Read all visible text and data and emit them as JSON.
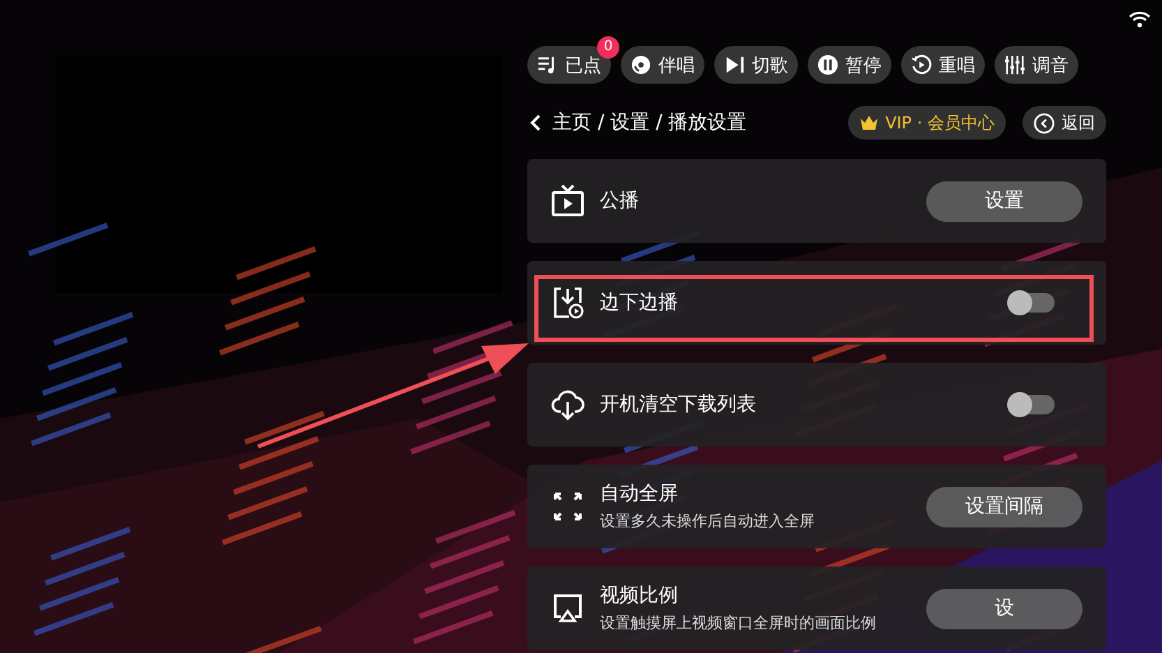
{
  "toolbar": [
    {
      "label": "已点",
      "badge": "0"
    },
    {
      "label": "伴唱"
    },
    {
      "label": "切歌"
    },
    {
      "label": "暂停"
    },
    {
      "label": "重唱"
    },
    {
      "label": "调音"
    }
  ],
  "breadcrumb": "主页 / 设置 / 播放设置",
  "vip_button": "VIP · 会员中心",
  "back_button": "返回",
  "settings": [
    {
      "kind": "button",
      "title": "公播",
      "button": "设置",
      "highlighted": false
    },
    {
      "kind": "toggle",
      "title": "边下边播",
      "on": false,
      "highlighted": true
    },
    {
      "kind": "toggle",
      "title": "开机清空下载列表",
      "on": false,
      "highlighted": false
    },
    {
      "kind": "button",
      "title": "自动全屏",
      "subtitle": "设置多久未操作后自动进入全屏",
      "button": "设置间隔",
      "highlighted": false
    },
    {
      "kind": "button",
      "title": "视频比例",
      "subtitle": "设置触摸屏上视频窗口全屏时的画面比例",
      "button": "设",
      "highlighted": false
    }
  ]
}
